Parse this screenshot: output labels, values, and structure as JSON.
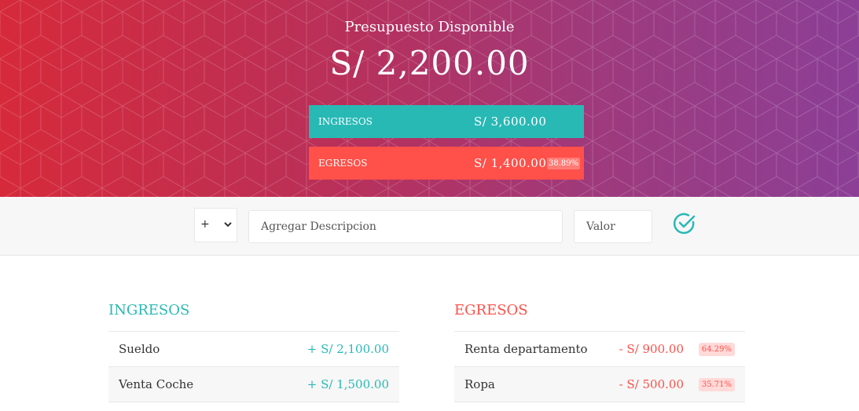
{
  "budget": {
    "title": "Presupuesto Disponible",
    "value": "S/ 2,200.00",
    "income": {
      "label": "INGRESOS",
      "value": "S/ 3,600.00"
    },
    "expense": {
      "label": "EGRESOS",
      "value": "S/ 1,400.00",
      "percentage": "38.89%"
    }
  },
  "add": {
    "type_value": "+",
    "description_placeholder": "Agregar Descripcion",
    "value_placeholder": "Valor",
    "submit_icon": "check-circle-icon"
  },
  "income_list": {
    "title": "INGRESOS",
    "items": [
      {
        "description": "Sueldo",
        "value": "+ S/ 2,100.00"
      },
      {
        "description": "Venta Coche",
        "value": "+ S/ 1,500.00"
      }
    ]
  },
  "expense_list": {
    "title": "EGRESOS",
    "items": [
      {
        "description": "Renta departamento",
        "value": "- S/ 900.00",
        "percentage": "64.29%"
      },
      {
        "description": "Ropa",
        "value": "- S/ 500.00",
        "percentage": "35.71%"
      }
    ]
  },
  "colors": {
    "income": "#28b9b5",
    "expense": "#ff5049",
    "header_start": "#d62a3a",
    "header_end": "#8b3f96"
  }
}
